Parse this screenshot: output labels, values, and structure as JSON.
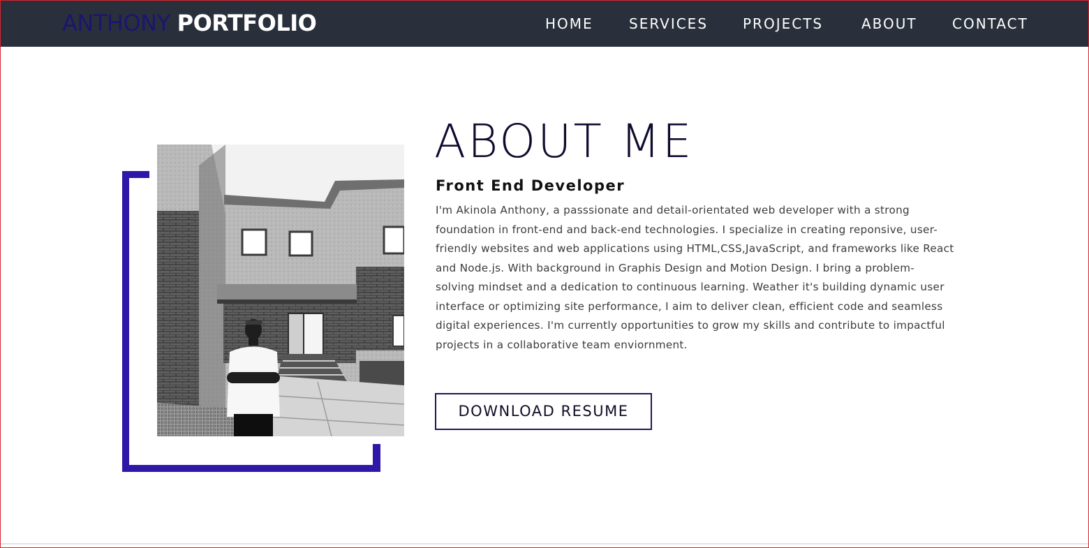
{
  "header": {
    "brand_first": "ANTHONY",
    "brand_second": "PORTFOLIO",
    "nav": [
      {
        "label": "HOME"
      },
      {
        "label": "SERVICES"
      },
      {
        "label": "PROJECTS"
      },
      {
        "label": "ABOUT"
      },
      {
        "label": "CONTACT"
      }
    ]
  },
  "about": {
    "title": "ABOUT ME",
    "subtitle": "Front End Developer",
    "bio_lines": [
      "I'm Akinola Anthony, a passsionate and detail-orientated web developer with a strong",
      "foundation in front-end and back-end technologies. I specialize in creating reponsive, user-",
      "friendly websites and web applications using HTML,CSS,JavaScript, and frameworks like React",
      "and Node.js. With background in Graphis Design and Motion Design. I bring a problem-",
      "solving mindset and a dedication to continuous learning. Weather it's building dynamic user",
      "interface or optimizing site performance, I aim to deliver clean, efficient code and seamless",
      "digital experiences. I'm currently opportunities to grow my skills and contribute to impactful",
      "projects in a collaborative team enviornment."
    ],
    "button_label": "DOWNLOAD RESUME"
  },
  "colors": {
    "nav_bg": "#29303b",
    "accent": "#2f18a8",
    "brand_first": "#1d1470"
  }
}
